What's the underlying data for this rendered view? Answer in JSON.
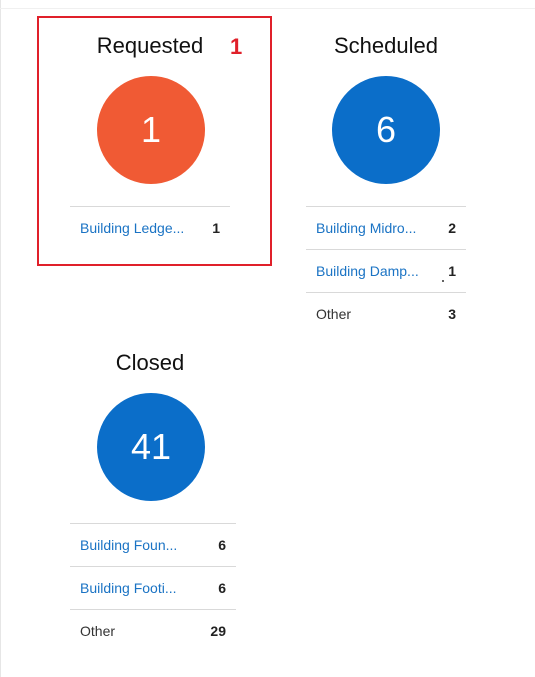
{
  "cards": [
    {
      "title": "Requested",
      "count": "1",
      "color": "#f05a34",
      "rows": [
        {
          "name": "Building Ledge...",
          "count": "1"
        }
      ]
    },
    {
      "title": "Scheduled",
      "count": "6",
      "color": "#0b6ec9",
      "rows": [
        {
          "name": "Building Midro...",
          "count": "2"
        },
        {
          "name": "Building Damp...",
          "count": "1"
        },
        {
          "name": "Other",
          "count": "3"
        }
      ]
    },
    {
      "title": "Closed",
      "count": "41",
      "color": "#0b6ec9",
      "rows": [
        {
          "name": "Building Foun...",
          "count": "6"
        },
        {
          "name": "Building Footi...",
          "count": "6"
        },
        {
          "name": "Other",
          "count": "29"
        }
      ]
    }
  ],
  "annotation": {
    "label": "1",
    "color": "#e0202a"
  }
}
